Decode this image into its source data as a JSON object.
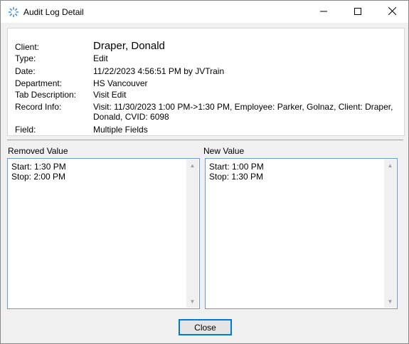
{
  "window": {
    "title": "Audit Log Detail",
    "icon": "spinner-icon",
    "controls": {
      "minimize": "minimize-icon",
      "maximize": "maximize-icon",
      "close": "close-icon"
    }
  },
  "details": {
    "client_label": "Client:",
    "client": "Draper, Donald",
    "type_label": "Type:",
    "type": "Edit",
    "date_label": "Date:",
    "date": "11/22/2023 4:56:51 PM by JVTrain",
    "department_label": "Department:",
    "department": "HS Vancouver",
    "tab_label": "Tab Description:",
    "tab": "Visit Edit",
    "record_label": "Record Info:",
    "record_line1": "Visit: 11/30/2023 1:00 PM->1:30 PM, Employee: Parker, Golnaz, Client: Draper,",
    "record_line2": "Donald, CVID: 6098",
    "field_label": "Field:",
    "field": "Multiple Fields"
  },
  "removed": {
    "label": "Removed Value",
    "text": "Start: 1:30 PM\nStop: 2:00 PM"
  },
  "new": {
    "label": "New Value",
    "text": "Start: 1:00 PM\nStop: 1:30 PM"
  },
  "buttons": {
    "close": "Close"
  },
  "colors": {
    "accent": "#0078d7",
    "textbox_border": "#6b9ad0"
  }
}
